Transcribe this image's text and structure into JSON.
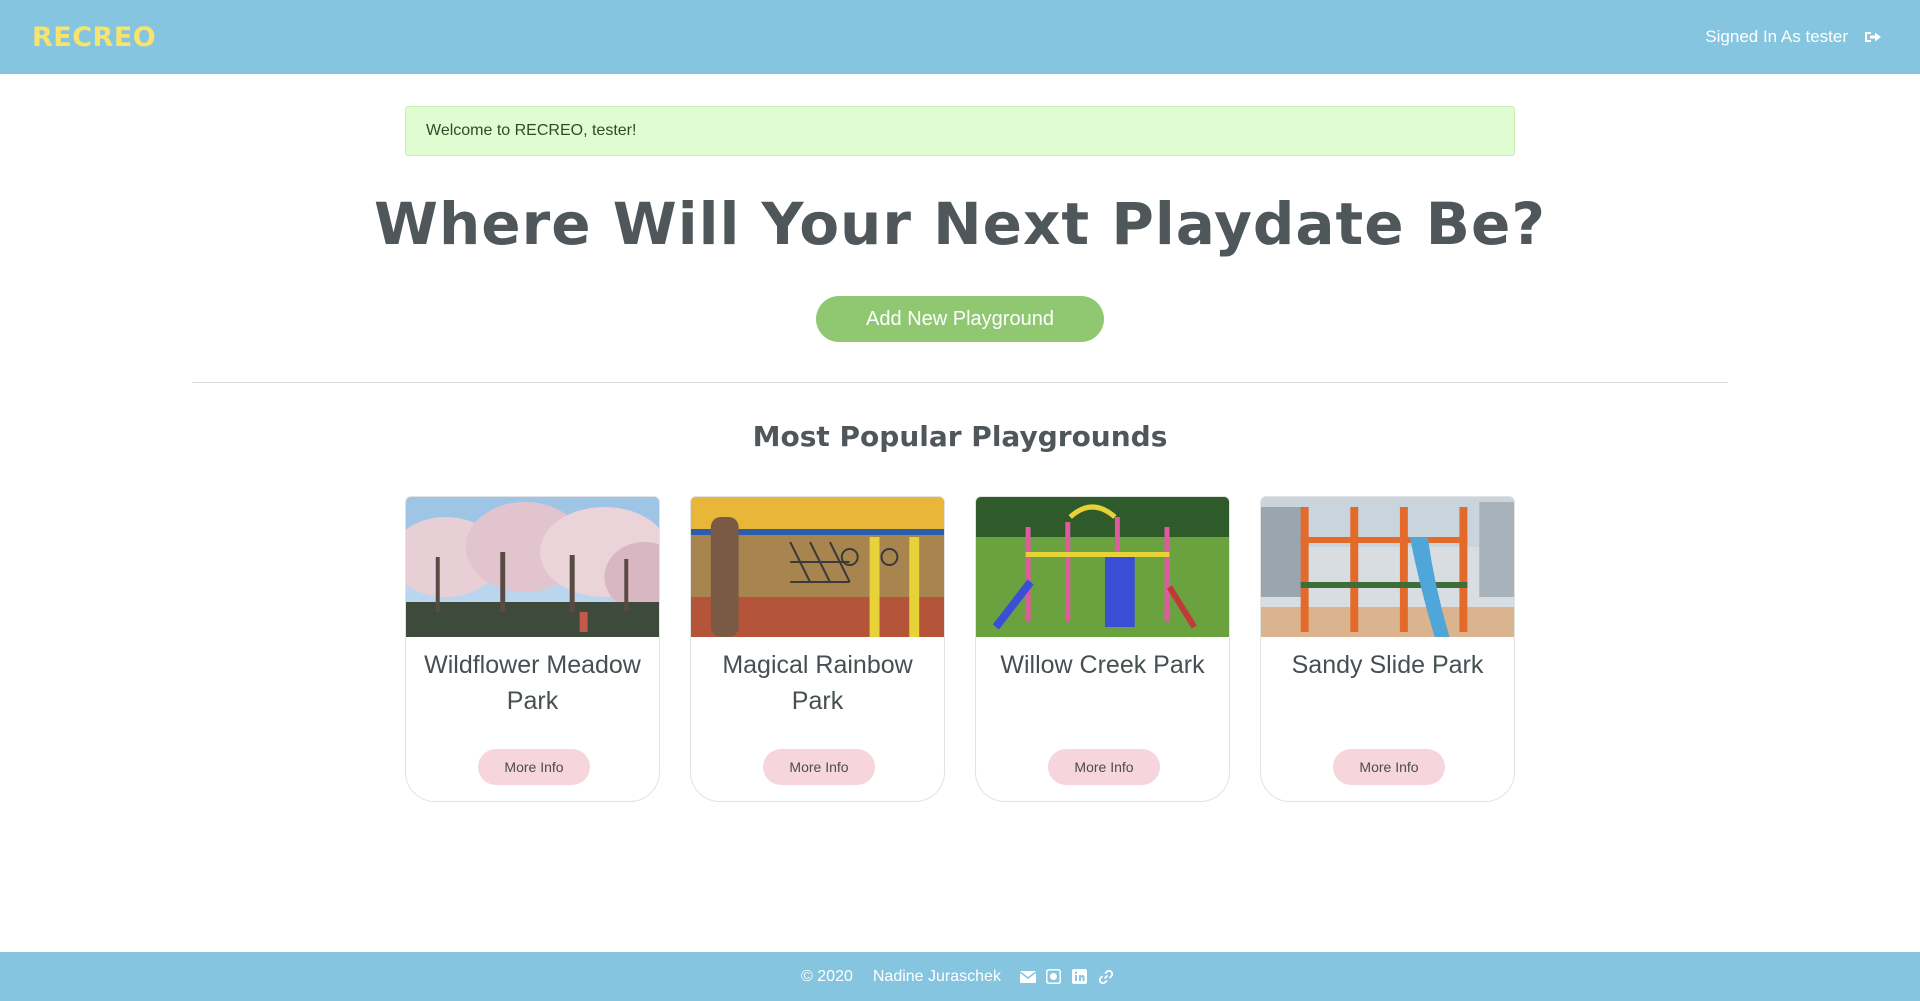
{
  "header": {
    "brand": "RECREO",
    "signed_in_text": "Signed In As tester",
    "signout_icon": "sign-out-icon"
  },
  "alert": {
    "message": "Welcome to RECREO, tester!"
  },
  "hero": {
    "title": "Where Will Your Next Playdate Be?",
    "add_button": "Add New Playground"
  },
  "popular": {
    "title": "Most Popular Playgrounds",
    "cards": [
      {
        "name": "Wildflower Meadow Park",
        "button": "More Info",
        "image": "cherry-blossom-park-photo"
      },
      {
        "name": "Magical Rainbow Park",
        "button": "More Info",
        "image": "rope-net-playground-photo"
      },
      {
        "name": "Willow Creek Park",
        "button": "More Info",
        "image": "colorful-climbing-frame-photo"
      },
      {
        "name": "Sandy Slide Park",
        "button": "More Info",
        "image": "orange-frame-blue-slide-photo"
      }
    ]
  },
  "footer": {
    "copyright": "© 2020",
    "author": "Nadine Juraschek",
    "icons": [
      "envelope-icon",
      "github-icon",
      "linkedin-icon",
      "link-icon"
    ]
  },
  "colors": {
    "header_bg": "#85c5e0",
    "brand": "#f8e36c",
    "alert_bg": "#dffdd0",
    "add_button": "#8fc871",
    "more_info_button": "#f6d6dc"
  }
}
